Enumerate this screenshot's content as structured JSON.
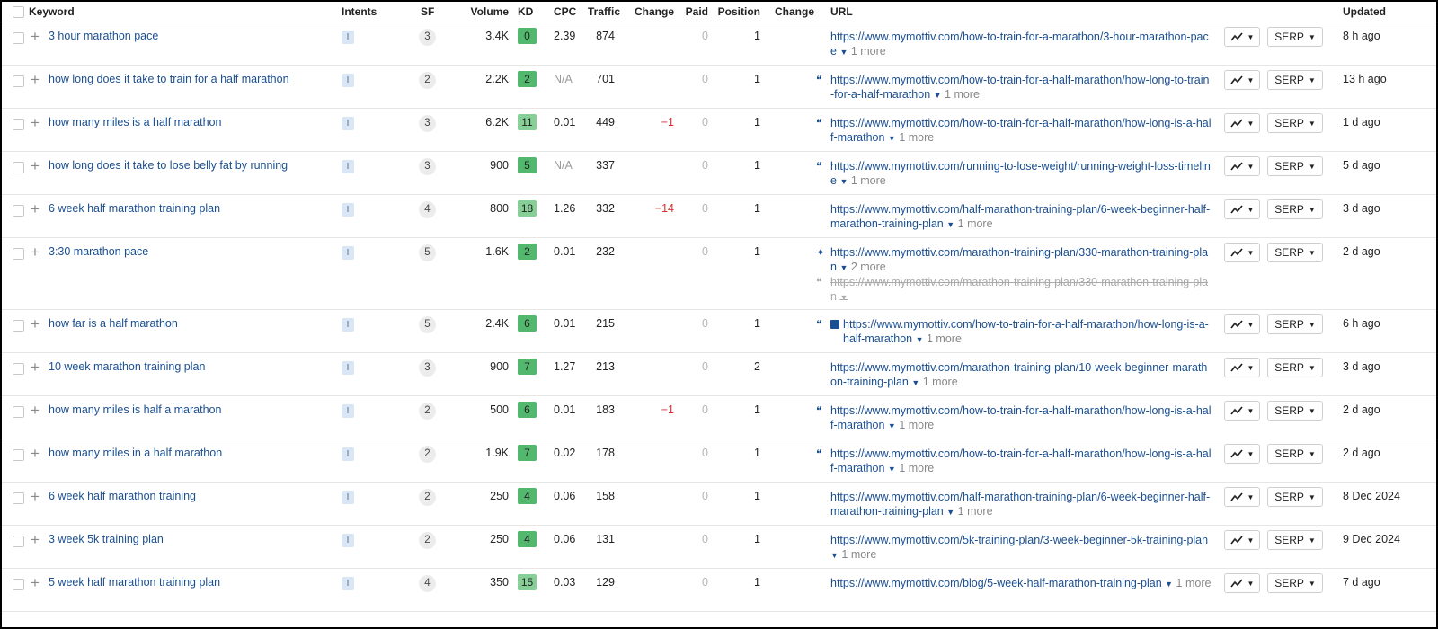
{
  "columns": {
    "keyword": "Keyword",
    "intents": "Intents",
    "sf": "SF",
    "volume": "Volume",
    "kd": "KD",
    "cpc": "CPC",
    "traffic": "Traffic",
    "change": "Change",
    "paid": "Paid",
    "position": "Position",
    "position_change": "Change",
    "url": "URL",
    "updated": "Updated"
  },
  "intent_label": "I",
  "serp_label": "SERP",
  "colors": {
    "link": "#1a4f91",
    "kd_dark": "#52b86e",
    "kd_light": "#86cf96",
    "negative": "#d62d2d"
  },
  "rows": [
    {
      "keyword": "3 hour marathon pace",
      "sf": "3",
      "volume": "3.4K",
      "kd": "0",
      "kd_tone": "d",
      "cpc": "2.39",
      "traffic": "874",
      "change": "",
      "paid": "0",
      "position": "1",
      "url_icons": [],
      "url_text": "https://www.mymottiv.com/how-to-train-for-a-marathon/3-hour-marathon-pace",
      "more": "1 more",
      "updated": "8 h ago"
    },
    {
      "keyword": "how long does it take to train for a half marathon",
      "sf": "2",
      "volume": "2.2K",
      "kd": "2",
      "kd_tone": "d",
      "cpc": "N/A",
      "traffic": "701",
      "change": "",
      "paid": "0",
      "position": "1",
      "url_icons": [
        "quote-icon"
      ],
      "url_text": "https://www.mymottiv.com/how-to-train-for-a-half-marathon/how-long-to-train-for-a-half-marathon",
      "more": "1 more",
      "updated": "13 h ago"
    },
    {
      "keyword": "how many miles is a half marathon",
      "sf": "3",
      "volume": "6.2K",
      "kd": "11",
      "kd_tone": "l",
      "cpc": "0.01",
      "traffic": "449",
      "change": "−1",
      "paid": "0",
      "position": "1",
      "url_icons": [
        "quote-icon"
      ],
      "url_text": "https://www.mymottiv.com/how-to-train-for-a-half-marathon/how-long-is-a-half-marathon",
      "more": "1 more",
      "updated": "1 d ago"
    },
    {
      "keyword": "how long does it take to lose belly fat by running",
      "sf": "3",
      "volume": "900",
      "kd": "5",
      "kd_tone": "d",
      "cpc": "N/A",
      "traffic": "337",
      "change": "",
      "paid": "0",
      "position": "1",
      "url_icons": [
        "quote-icon"
      ],
      "url_text": "https://www.mymottiv.com/running-to-lose-weight/running-weight-loss-timeline",
      "more": "1 more",
      "updated": "5 d ago"
    },
    {
      "keyword": "6 week half marathon training plan",
      "sf": "4",
      "volume": "800",
      "kd": "18",
      "kd_tone": "l",
      "cpc": "1.26",
      "traffic": "332",
      "change": "−14",
      "paid": "0",
      "position": "1",
      "url_icons": [],
      "url_text": "https://www.mymottiv.com/half-marathon-training-plan/6-week-beginner-half-marathon-training-plan",
      "more": "1 more",
      "updated": "3 d ago"
    },
    {
      "keyword": "3:30 marathon pace",
      "sf": "5",
      "volume": "1.6K",
      "kd": "2",
      "kd_tone": "d",
      "cpc": "0.01",
      "traffic": "232",
      "change": "",
      "paid": "0",
      "position": "1",
      "url_icons": [
        "sparkle-icon"
      ],
      "url_text": "https://www.mymottiv.com/marathon-training-plan/330-marathon-training-plan",
      "more": "2 more",
      "extra_url": "https://www.mymottiv.com/marathon-training-plan/330-marathon-training-plan",
      "updated": "2 d ago"
    },
    {
      "keyword": "how far is a half marathon",
      "sf": "5",
      "volume": "2.4K",
      "kd": "6",
      "kd_tone": "d",
      "cpc": "0.01",
      "traffic": "215",
      "change": "",
      "paid": "0",
      "position": "1",
      "url_icons": [
        "quote-icon",
        "image-icon"
      ],
      "url_text": "https://www.mymottiv.com/how-to-train-for-a-half-marathon/how-long-is-a-half-marathon",
      "more": "1 more",
      "updated": "6 h ago"
    },
    {
      "keyword": "10 week marathon training plan",
      "sf": "3",
      "volume": "900",
      "kd": "7",
      "kd_tone": "d",
      "cpc": "1.27",
      "traffic": "213",
      "change": "",
      "paid": "0",
      "position": "2",
      "url_icons": [],
      "url_text": "https://www.mymottiv.com/marathon-training-plan/10-week-beginner-marathon-training-plan",
      "more": "1 more",
      "updated": "3 d ago"
    },
    {
      "keyword": "how many miles is half a marathon",
      "sf": "2",
      "volume": "500",
      "kd": "6",
      "kd_tone": "d",
      "cpc": "0.01",
      "traffic": "183",
      "change": "−1",
      "paid": "0",
      "position": "1",
      "url_icons": [
        "quote-icon"
      ],
      "url_text": "https://www.mymottiv.com/how-to-train-for-a-half-marathon/how-long-is-a-half-marathon",
      "more": "1 more",
      "updated": "2 d ago"
    },
    {
      "keyword": "how many miles in a half marathon",
      "sf": "2",
      "volume": "1.9K",
      "kd": "7",
      "kd_tone": "d",
      "cpc": "0.02",
      "traffic": "178",
      "change": "",
      "paid": "0",
      "position": "1",
      "url_icons": [
        "quote-icon"
      ],
      "url_text": "https://www.mymottiv.com/how-to-train-for-a-half-marathon/how-long-is-a-half-marathon",
      "more": "1 more",
      "updated": "2 d ago"
    },
    {
      "keyword": "6 week half marathon training",
      "sf": "2",
      "volume": "250",
      "kd": "4",
      "kd_tone": "d",
      "cpc": "0.06",
      "traffic": "158",
      "change": "",
      "paid": "0",
      "position": "1",
      "url_icons": [],
      "url_text": "https://www.mymottiv.com/half-marathon-training-plan/6-week-beginner-half-marathon-training-plan",
      "more": "1 more",
      "updated": "8 Dec 2024"
    },
    {
      "keyword": "3 week 5k training plan",
      "sf": "2",
      "volume": "250",
      "kd": "4",
      "kd_tone": "d",
      "cpc": "0.06",
      "traffic": "131",
      "change": "",
      "paid": "0",
      "position": "1",
      "url_icons": [],
      "url_text": "https://www.mymottiv.com/5k-training-plan/3-week-beginner-5k-training-plan",
      "more": "1 more",
      "updated": "9 Dec 2024"
    },
    {
      "keyword": "5 week half marathon training plan",
      "sf": "4",
      "volume": "350",
      "kd": "15",
      "kd_tone": "l",
      "cpc": "0.03",
      "traffic": "129",
      "change": "",
      "paid": "0",
      "position": "1",
      "url_icons": [],
      "url_text": "https://www.mymottiv.com/blog/5-week-half-marathon-training-plan",
      "more": "1 more",
      "updated": "7 d ago"
    }
  ]
}
